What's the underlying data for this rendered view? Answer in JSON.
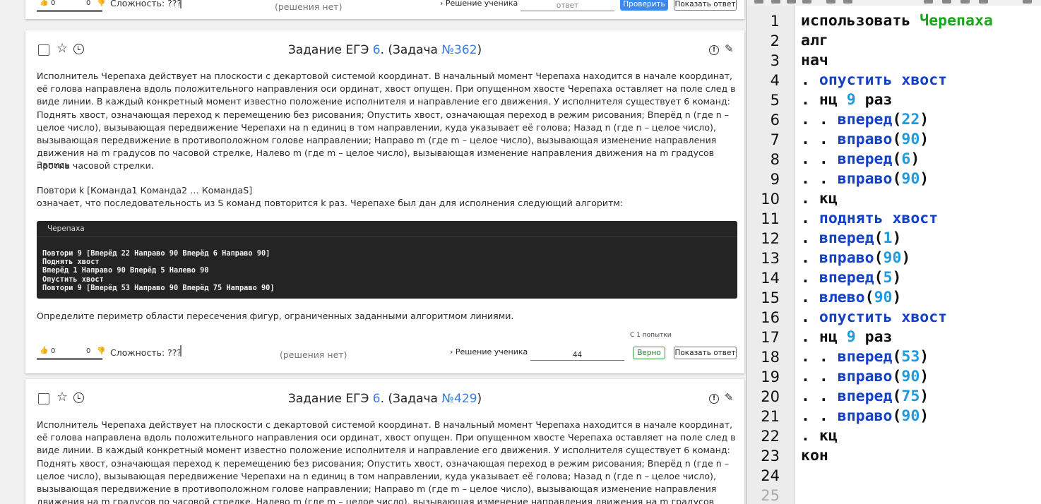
{
  "common": {
    "difficulty": "Сложность: ???",
    "no_solution": "(решения нет)",
    "student_solution": "Решение ученика",
    "check_label": "Проверить",
    "show_answer_label": "Показать ответ",
    "answer_placeholder": "ответ"
  },
  "top_card": {
    "likes": "0",
    "dislikes": "0"
  },
  "task_362": {
    "title_prefix": "Задание ЕГЭ",
    "task_number": "6",
    "title_mid": ". (Задача",
    "problem_number": "№362",
    "title_suffix": ")",
    "paragraph1": "Исполнитель Черепаха действует на плоскости с декартовой системой координат. В начальный момент Черепаха находится в начале координат, её голова направлена вдоль положительного направления оси ординат, хвост опущен. При опущенном хвосте Черепаха оставляет на поле след в виде линии. В каждый конкретный момент известно положение исполнителя и направление его движения. У исполнителя существует 6 команд: Поднять хвост, означающая переход к перемещению без рисования; Опустить хвост, означающая переход в режим рисования; Вперёд n (где n – целое число), вызывающая передвижение Черепахи на n единиц в том направлении, куда указывает её голова; Назад n (где n – целое число), вызывающая передвижение в противоположном голове направлении; Направо m (где m – целое число), вызывающая изменение направления движения на m градусов по часовой стрелке, Налево m (где m – целое число), вызывающая изменение направления движения на m градусов против часовой стрелки.",
    "record_label": "Запись",
    "repeat_syntax": "Повтори k [Команда1 Команда2 … КомандаS]",
    "repeat_meaning": "означает, что последовательность из S команд повторится k раз. Черепахе был дан для исполнения следующий алгоритм:",
    "code_lang": "Черепаха",
    "code_lines": [
      "Повтори 9 [Вперёд 22 Направо 90 Вперёд 6 Направо 90]",
      "Поднять хвост",
      "Вперёд 1 Направо 90 Вперёд 5 Налево 90",
      "Опустить хвост",
      "Повтори 9 [Вперёд 53 Направо 90 Вперёд 75 Направо 90]"
    ],
    "question": "Определите периметр области пересечения фигур, ограниченных заданными алгоритмом линиями.",
    "attempts": "С 1 попытки",
    "likes": "0",
    "dislikes": "0",
    "answer_value": "44",
    "correct_label": "Верно"
  },
  "task_429": {
    "title_prefix": "Задание ЕГЭ",
    "task_number": "6",
    "title_mid": ". (Задача",
    "problem_number": "№429",
    "title_suffix": ")",
    "paragraph1": "Исполнитель Черепаха действует на плоскости с декартовой системой координат. В начальный момент Черепаха находится в начале координат, её голова направлена вдоль положительного направления оси ординат, хвост опущен. При опущенном хвосте Черепаха оставляет на поле след в виде линии. В каждый конкретный момент известно положение исполнителя и направление его движения. У исполнителя существует 6 команд: Поднять хвост, означающая переход к перемещению без рисования; Опустить хвост, означающая переход в режим рисования; Вперёд n (где n – целое число), вызывающая передвижение Черепахи на n единиц в том направлении, куда указывает её голова; Назад n (где n – целое число), вызывающая передвижение в противоположном голове направлении; Направо m (где m – целое число), вызывающая изменение направления движения на m градусов по часовой стрелке, Налево m (где m – целое число), вызывающая изменение направления движения на m градусов против часовой стрелки."
  },
  "editor": {
    "line_numbers": [
      "1",
      "2",
      "3",
      "4",
      "5",
      "6",
      "7",
      "8",
      "9",
      "10",
      "11",
      "12",
      "13",
      "14",
      "15",
      "16",
      "17",
      "18",
      "19",
      "20",
      "21",
      "22",
      "23",
      "24",
      "25"
    ],
    "lines": [
      [
        [
          "k",
          "использовать "
        ],
        [
          "g",
          "Черепаха"
        ]
      ],
      [
        [
          "k",
          "алг"
        ]
      ],
      [
        [
          "k",
          "нач"
        ]
      ],
      [
        [
          "k",
          "."
        ],
        [
          "b",
          " опустить хвост"
        ]
      ],
      [
        [
          "k",
          ". нц "
        ],
        [
          "n",
          "9"
        ],
        [
          "k",
          " раз"
        ]
      ],
      [
        [
          "k",
          ". . "
        ],
        [
          "b",
          "вперед"
        ],
        [
          "p",
          "("
        ],
        [
          "n",
          "22"
        ],
        [
          "p",
          ")"
        ]
      ],
      [
        [
          "k",
          ". . "
        ],
        [
          "b",
          "вправо"
        ],
        [
          "p",
          "("
        ],
        [
          "n",
          "90"
        ],
        [
          "p",
          ")"
        ]
      ],
      [
        [
          "k",
          ". . "
        ],
        [
          "b",
          "вперед"
        ],
        [
          "p",
          "("
        ],
        [
          "n",
          "6"
        ],
        [
          "p",
          ")"
        ]
      ],
      [
        [
          "k",
          ". . "
        ],
        [
          "b",
          "вправо"
        ],
        [
          "p",
          "("
        ],
        [
          "n",
          "90"
        ],
        [
          "p",
          ")"
        ]
      ],
      [
        [
          "k",
          ". кц"
        ]
      ],
      [
        [
          "k",
          "."
        ],
        [
          "b",
          " поднять хвост"
        ]
      ],
      [
        [
          "k",
          ". "
        ],
        [
          "b",
          "вперед"
        ],
        [
          "p",
          "("
        ],
        [
          "n",
          "1"
        ],
        [
          "p",
          ")"
        ]
      ],
      [
        [
          "k",
          ". "
        ],
        [
          "b",
          "вправо"
        ],
        [
          "p",
          "("
        ],
        [
          "n",
          "90"
        ],
        [
          "p",
          ")"
        ]
      ],
      [
        [
          "k",
          ". "
        ],
        [
          "b",
          "вперед"
        ],
        [
          "p",
          "("
        ],
        [
          "n",
          "5"
        ],
        [
          "p",
          ")"
        ]
      ],
      [
        [
          "k",
          ". "
        ],
        [
          "b",
          "влево"
        ],
        [
          "p",
          "("
        ],
        [
          "n",
          "90"
        ],
        [
          "p",
          ")"
        ]
      ],
      [
        [
          "k",
          "."
        ],
        [
          "b",
          " опустить хвост"
        ]
      ],
      [
        [
          "k",
          ". нц "
        ],
        [
          "n",
          "9"
        ],
        [
          "k",
          " раз"
        ]
      ],
      [
        [
          "k",
          ". . "
        ],
        [
          "b",
          "вперед"
        ],
        [
          "p",
          "("
        ],
        [
          "n",
          "53"
        ],
        [
          "p",
          ")"
        ]
      ],
      [
        [
          "k",
          ". . "
        ],
        [
          "b",
          "вправо"
        ],
        [
          "p",
          "("
        ],
        [
          "n",
          "90"
        ],
        [
          "p",
          ")"
        ]
      ],
      [
        [
          "k",
          ". . "
        ],
        [
          "b",
          "вперед"
        ],
        [
          "p",
          "("
        ],
        [
          "n",
          "75"
        ],
        [
          "p",
          ")"
        ]
      ],
      [
        [
          "k",
          ". . "
        ],
        [
          "b",
          "вправо"
        ],
        [
          "p",
          "("
        ],
        [
          "n",
          "90"
        ],
        [
          "p",
          ")"
        ]
      ],
      [
        [
          "k",
          ". кц"
        ]
      ],
      [
        [
          "k",
          "кон"
        ]
      ],
      [],
      []
    ]
  }
}
